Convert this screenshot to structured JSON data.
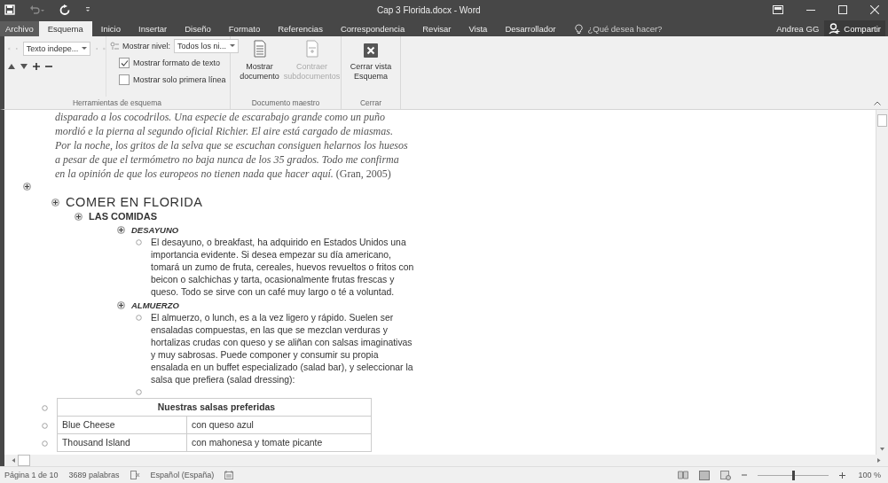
{
  "window": {
    "title": "Cap 3 Florida.docx - Word"
  },
  "tabs": [
    {
      "label": "Archivo",
      "kind": "file",
      "selected": false
    },
    {
      "label": "Esquema",
      "kind": "tab",
      "selected": true
    },
    {
      "label": "Inicio",
      "kind": "tab",
      "selected": false
    },
    {
      "label": "Insertar",
      "kind": "tab",
      "selected": false
    },
    {
      "label": "Diseño",
      "kind": "tab",
      "selected": false
    },
    {
      "label": "Formato",
      "kind": "tab",
      "selected": false
    },
    {
      "label": "Referencias",
      "kind": "tab",
      "selected": false
    },
    {
      "label": "Correspondencia",
      "kind": "tab",
      "selected": false
    },
    {
      "label": "Revisar",
      "kind": "tab",
      "selected": false
    },
    {
      "label": "Vista",
      "kind": "tab",
      "selected": false
    },
    {
      "label": "Desarrollador",
      "kind": "tab",
      "selected": false
    }
  ],
  "tell_me": {
    "placeholder": "¿Qué desea hacer?"
  },
  "user": "Andrea GG",
  "share_button": "Compartir",
  "ribbon": {
    "outline_tools": {
      "level_dropdown": "Texto indepe...",
      "show_level_label": "Mostrar nivel:",
      "show_level_dropdown": "Todos los ni...",
      "checkboxes": [
        {
          "label": "Mostrar formato de texto",
          "checked": true
        },
        {
          "label": "Mostrar solo primera línea",
          "checked": false
        }
      ],
      "group_label": "Herramientas de esquema"
    },
    "master_document": {
      "buttons": [
        {
          "label": "Mostrar documento",
          "disabled": false
        },
        {
          "label": "Contraer subdocumentos",
          "disabled": true
        }
      ],
      "group_label": "Documento maestro"
    },
    "close": {
      "button": "Cerrar vista Esquema",
      "group_label": "Cerrar"
    }
  },
  "outline": [
    {
      "kind": "quote",
      "text": "*disparado a los cocodrilos. Una especie de escarabajo grande como un puño mordió e la pierna al segundo oficial Richier. El aire está cargado de miasmas. Por la noche, los gritos de la selva que se escuchan consiguen helarnos los huesos a pesar de que el termómetro no baja nunca de los 35 grados. Todo me confirma en la opinión de que los europeos no tienen nada que hacer aquí.* (Gran, 2005)"
    },
    {
      "kind": "empty"
    },
    {
      "kind": "heading1",
      "text": "COMER EN FLORIDA",
      "children": [
        {
          "kind": "heading2",
          "text": "LAS COMIDAS",
          "children": [
            {
              "kind": "heading3",
              "text": "DESAYUNO",
              "children": [
                {
                  "kind": "body",
                  "text": "El desayuno, o breakfast, ha adquirido en Estados Unidos una importancia evidente. Si desea empezar su día americano, tomará un zumo de fruta, cereales, huevos revueltos o fritos con beicon o salchichas y tarta, ocasionalmente frutas frescas y queso. Todo se sirve con un café muy largo o té a voluntad."
                }
              ]
            },
            {
              "kind": "heading3",
              "text": "ALMUERZO",
              "children": [
                {
                  "kind": "body",
                  "text": "El almuerzo, o lunch, es a la vez ligero y rápido. Suelen ser ensaladas compuestas, en las que se mezclan verduras y hortalizas crudas con queso y se aliñan con salsas imaginativas y muy sabrosas. Puede componer y consumir su propia ensalada en un buffet especializado (salad bar), y seleccionar la salsa que prefiera (salad dressing):"
                },
                {
                  "kind": "body"
                }
              ]
            }
          ]
        }
      ]
    }
  ],
  "table": {
    "title": "Nuestras salsas preferidas",
    "rows": [
      [
        "Blue Cheese",
        "con queso azul"
      ],
      [
        "Thousand Island",
        "con mahonesa y tomate picante"
      ]
    ]
  },
  "status_bar": {
    "page": "Página 1 de 10",
    "words": "3689 palabras",
    "language": "Español (España)",
    "zoom_slider": {
      "level": 0.5
    },
    "zoom": "100 %"
  }
}
